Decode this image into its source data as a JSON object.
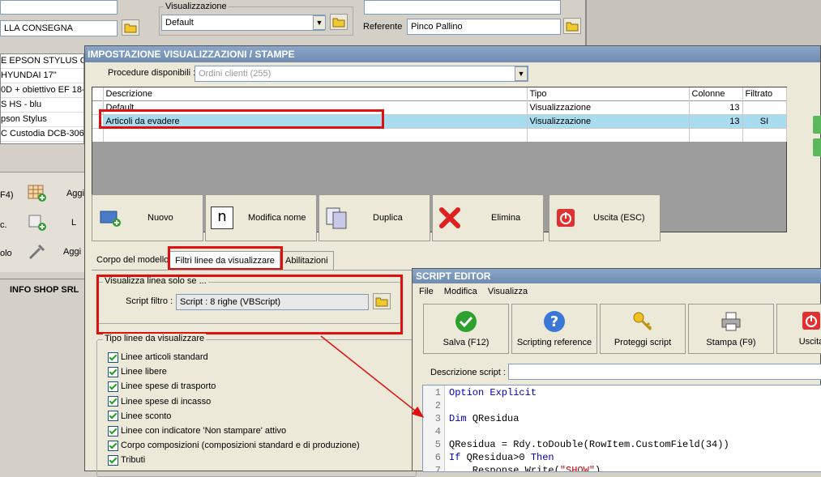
{
  "background": {
    "visualizzazione_label": "Visualizzazione",
    "visualizzazione_value": "Default",
    "consegna_value": "LLA CONSEGNA",
    "referente_label": "Referente",
    "referente_value": "Pinco Pallino",
    "product_list": [
      "E EPSON STYLUS COL",
      "HYUNDAI 17\"",
      "0D + obiettivo EF 18-",
      "S HS - blu",
      "pson Stylus",
      "C Custodia DCB-306"
    ],
    "left_buttons": [
      {
        "key": "F4)",
        "label": "Aggi"
      },
      {
        "key": "c.",
        "label": "L"
      },
      {
        "key": "olo",
        "label": "Aggi"
      }
    ],
    "company": "INFO SHOP SRL"
  },
  "dialog": {
    "title": "IMPOSTAZIONE VISUALIZZAZIONI / STAMPE",
    "procedure_label": "Procedure disponibili :",
    "procedure_value": "Ordini clienti (255)",
    "table": {
      "headers": [
        "Descrizione",
        "Tipo",
        "Colonne",
        "Filtrato"
      ],
      "rows": [
        {
          "descrizione": "Default",
          "tipo": "Visualizzazione",
          "colonne": "13",
          "filtrato": ""
        },
        {
          "descrizione": "Articoli da evadere",
          "tipo": "Visualizzazione",
          "colonne": "13",
          "filtrato": "SI"
        }
      ]
    },
    "buttons": {
      "nuovo": "Nuovo",
      "modifica": "Modifica nome",
      "duplica": "Duplica",
      "elimina": "Elimina",
      "uscita": "Uscita (ESC)"
    },
    "tabs": [
      "Corpo del modello",
      "Filtri linee da visualizzare",
      "Abilitazioni"
    ],
    "filter_group": {
      "title": "Visualizza linea solo se ...",
      "script_label": "Script filtro :",
      "script_value": "Script : 8 righe (VBScript)"
    },
    "line_types": {
      "title": "Tipo linee da visualizzare",
      "items": [
        "Linee articoli standard",
        "Linee libere",
        "Linee spese di trasporto",
        "Linee spese di incasso",
        "Linee sconto",
        "Linee con indicatore 'Non stampare' attivo",
        "Corpo composizioni (composizioni standard e di produzione)",
        "Tributi"
      ]
    }
  },
  "script_editor": {
    "title": "SCRIPT EDITOR",
    "menu": [
      "File",
      "Modifica",
      "Visualizza"
    ],
    "buttons": [
      "Salva (F12)",
      "Scripting reference",
      "Proteggi script",
      "Stampa (F9)",
      "Uscita"
    ],
    "descrizione_label": "Descrizione script :",
    "code": [
      {
        "n": "1",
        "parts": [
          {
            "t": "Option Explicit",
            "c": "kw"
          }
        ]
      },
      {
        "n": "2",
        "parts": []
      },
      {
        "n": "3",
        "parts": [
          {
            "t": "Dim ",
            "c": "kw"
          },
          {
            "t": "QResidua",
            "c": ""
          }
        ]
      },
      {
        "n": "4",
        "parts": []
      },
      {
        "n": "5",
        "parts": [
          {
            "t": "QResidua = Rdy.toDouble(RowItem.CustomField(34))",
            "c": ""
          }
        ]
      },
      {
        "n": "6",
        "parts": [
          {
            "t": "If ",
            "c": "kw"
          },
          {
            "t": "QResidua>0 ",
            "c": ""
          },
          {
            "t": "Then",
            "c": "kw"
          }
        ]
      },
      {
        "n": "7",
        "parts": [
          {
            "t": "    Response.Write(",
            "c": ""
          },
          {
            "t": "\"SHOW\"",
            "c": "str"
          },
          {
            "t": ")",
            "c": ""
          }
        ]
      }
    ]
  },
  "colors": {
    "title_bar": "#7a96b8",
    "dialog_bg": "#ece9d8",
    "highlight": "#a8dcee",
    "annotation": "#e01010"
  }
}
